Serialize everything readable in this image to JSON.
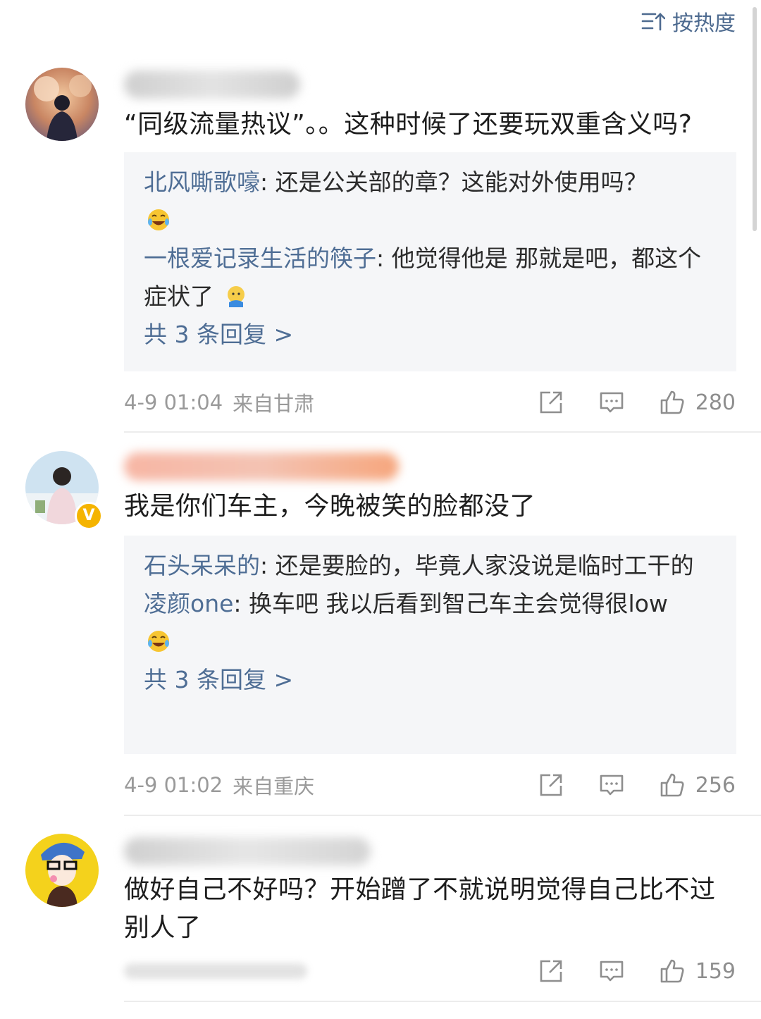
{
  "sort_label": "按热度",
  "comments": [
    {
      "text": "“同级流量热议”。。这种时候了还要玩双重含义吗?",
      "replies": [
        {
          "name": "北风嘶歌嚎",
          "text": ": 还是公关部的章？这能对外使用吗？",
          "emoji": "laugh-cry-icon"
        },
        {
          "name": "一根爱记录生活的筷子",
          "text": ": 他觉得他是 那就是吧，都这个症状了",
          "emoji": "face-emoji-icon"
        }
      ],
      "more": "共 3 条回复 >",
      "time": "4-9 01:04",
      "location": "来自甘肃",
      "likes": "280"
    },
    {
      "text": "我是你们车主，今晚被笑的脸都没了",
      "verified": "V",
      "replies": [
        {
          "name": "石头呆呆的",
          "text": ": 还是要脸的，毕竟人家没说是临时工干的"
        },
        {
          "name": "凌颜one",
          "text": ": 换车吧 我以后看到智己车主会觉得很low",
          "emoji": "laugh-cry-icon"
        }
      ],
      "more": "共 3 条回复 >",
      "time": "4-9 01:02",
      "location": "来自重庆",
      "likes": "256"
    },
    {
      "text": "做好自己不好吗？开始蹭了不就说明觉得自己比不过别人了",
      "likes": "159"
    }
  ]
}
